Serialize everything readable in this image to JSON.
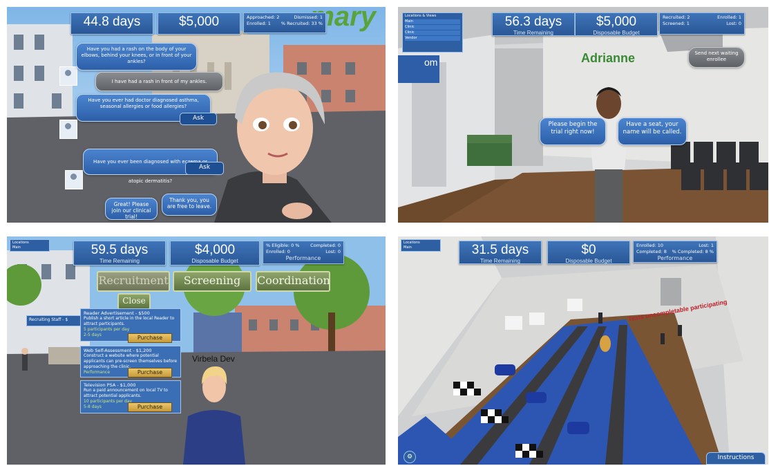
{
  "p1": {
    "time": {
      "value": "44.8 days"
    },
    "budget": {
      "value": "$5,000"
    },
    "perf": {
      "approached": "Approached: 2",
      "dismissed": "Dismissed: 1",
      "enrolled": "Enrolled: 1",
      "pct_recruited": "% Recruited: 33 %"
    },
    "title_fragment": "...mary",
    "q1": "Have you had a rash on the body of your elbows, behind your knees, or in front of your ankles?",
    "a1": "I have had a rash in front of my ankles.",
    "q2": "Have you ever had doctor diagnosed asthma, seasonal allergies or food allergies?",
    "ask1": "Ask",
    "q3": "Have you ever been diagnosed with eczema or atopic dermatitis?",
    "ask2": "Ask",
    "join": "Great! Please join our clinical trial!",
    "leave": "Thank you, you are free to leave."
  },
  "p2": {
    "time": {
      "value": "56.3 days",
      "label": "Time Remaining"
    },
    "budget": {
      "value": "$5,000",
      "label": "Disposable Budget"
    },
    "perf": {
      "recruited": "Recruited: 2",
      "enrolled": "Enrolled: 1",
      "screened": "Screened: 1",
      "lost": "Lost: 0"
    },
    "menu": [
      "Locations & Views",
      "Main",
      "Clinic",
      "Clinic",
      "Vendor"
    ],
    "sign": "om",
    "name": "Adrianne",
    "send_next": "Send next waiting enrollee",
    "begin": "Please begin the trial right now!",
    "seat": "Have a seat, your name will be called."
  },
  "p3": {
    "time": {
      "value": "59.5 days",
      "label": "Time Remaining"
    },
    "budget": {
      "value": "$4,000",
      "label": "Disposable Budget"
    },
    "perf": {
      "eligible": "% Eligible: 0 %",
      "completed": "Completed: 0",
      "enrolled": "Enrolled: 0",
      "lost": "Lost: 0",
      "label": "Performance"
    },
    "tabs": {
      "recruitment": "Recruitment",
      "screening": "Screening",
      "coordination": "Coordination",
      "close": "Close"
    },
    "side_label": "Recruiting Staff - $",
    "cards": [
      {
        "title": "Reader Advertisement - $500",
        "desc": "Publish a short article in the local Reader to attract participants.",
        "extra": "5 participants per day",
        "dur": "2-5 days",
        "button": "Purchase"
      },
      {
        "title": "Web Self-Assessment - $1,200",
        "desc": "Construct a website where potential applicants can pre-screen themselves before approaching the clinic.",
        "extra": "Performance",
        "dur": "",
        "button": "Purchase"
      },
      {
        "title": "Television PSA - $1,000",
        "desc": "Run a paid announcement on local TV to attract potential applicants.",
        "extra": "10 participants per day",
        "dur": "5-8 days",
        "button": "Purchase"
      }
    ],
    "avatar_name": "Virbela Dev",
    "corner_menu": [
      "Locations",
      "Main"
    ]
  },
  "p4": {
    "time": {
      "value": "31.5 days",
      "label": "Time Remaining"
    },
    "budget": {
      "value": "$0",
      "label": "Disposable Budget"
    },
    "perf": {
      "enrolled": "Enrolled: 10",
      "lost": "Lost: 1",
      "completed": "Completed: 8",
      "pct_completed": "% Completed: 8 %",
      "label": "Performance"
    },
    "float_text": "Tests uncompletable participating",
    "instructions": "Instructions",
    "corner_menu": [
      "Locations",
      "Main"
    ]
  }
}
